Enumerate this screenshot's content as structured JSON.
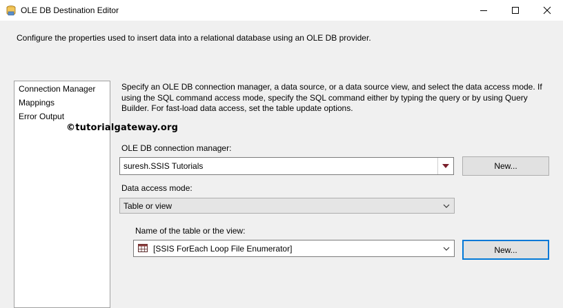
{
  "window": {
    "title": "OLE DB Destination Editor",
    "icons": [
      "app-icon",
      "minimize-icon",
      "maximize-icon",
      "close-icon"
    ]
  },
  "description": "Configure the properties used to insert data into a relational database using an OLE DB provider.",
  "nav": {
    "items": [
      {
        "label": "Connection Manager"
      },
      {
        "label": "Mappings"
      },
      {
        "label": "Error Output"
      }
    ]
  },
  "main": {
    "description_lines": [
      "Specify an OLE DB connection manager, a data source, or a data source view, and select the data access mode. If",
      "using the SQL command access mode, specify the SQL command either by typing the query or by using Query",
      "Builder. For fast-load data access, set the table update options."
    ],
    "watermark": "©tutorialgateway.org",
    "connection_label": "OLE DB connection manager:",
    "connection_value": "suresh.SSIS Tutorials",
    "new_label_1": "New...",
    "access_mode_label": "Data access mode:",
    "access_mode_value": "Table or view",
    "table_label": "Name of the table or the view:",
    "table_value": "[SSIS ForEach Loop File Enumerator]",
    "table_icon": "table-icon",
    "new_label_2": "New..."
  },
  "colors": {
    "background": "#f0f0f0",
    "dropdown_arrow_active": "#7a1f2b",
    "focus_border": "#0078d7"
  }
}
